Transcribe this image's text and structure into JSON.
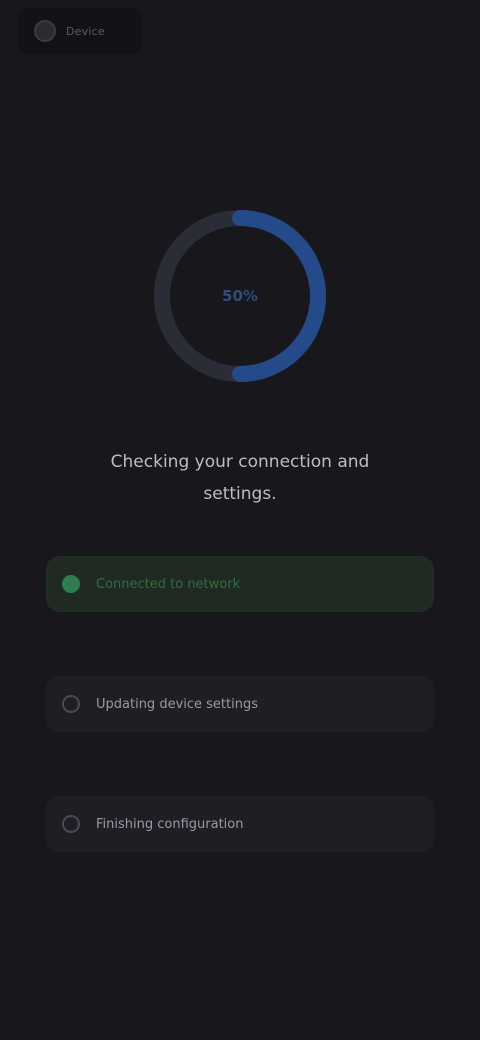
{
  "topChip": {
    "icon": "device-icon",
    "label": "Device"
  },
  "progress": {
    "value": 0.5,
    "text": "50%",
    "trackColor": "#2a2c36",
    "fillColor": "#254a8a"
  },
  "message": "Checking your connection and settings.",
  "options": [
    {
      "label": "Connected to network",
      "selected": true
    },
    {
      "label": "Updating device settings",
      "selected": false
    },
    {
      "label": "Finishing configuration",
      "selected": false
    }
  ]
}
